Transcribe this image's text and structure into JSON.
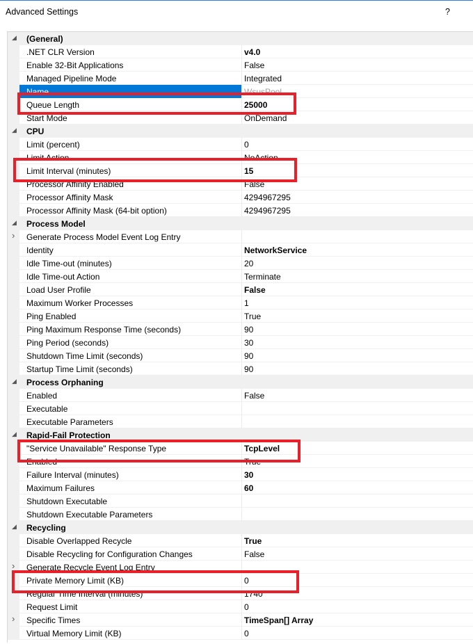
{
  "window": {
    "title": "Advanced Settings",
    "help": "?"
  },
  "groups": [
    {
      "category": "(General)",
      "rows": [
        {
          "name": ".NET CLR Version",
          "value": "v4.0",
          "bold": true
        },
        {
          "name": "Enable 32-Bit Applications",
          "value": "False"
        },
        {
          "name": "Managed Pipeline Mode",
          "value": "Integrated"
        },
        {
          "name": "Name",
          "value": "WsusPool",
          "selected": true
        },
        {
          "name": "Queue Length",
          "value": "25000",
          "bold": true
        },
        {
          "name": "Start Mode",
          "value": "OnDemand"
        }
      ]
    },
    {
      "category": "CPU",
      "rows": [
        {
          "name": "Limit (percent)",
          "value": "0"
        },
        {
          "name": "Limit Action",
          "value": "NoAction"
        },
        {
          "name": "Limit Interval (minutes)",
          "value": "15",
          "bold": true
        },
        {
          "name": "Processor Affinity Enabled",
          "value": "False"
        },
        {
          "name": "Processor Affinity Mask",
          "value": "4294967295"
        },
        {
          "name": "Processor Affinity Mask (64-bit option)",
          "value": "4294967295"
        }
      ]
    },
    {
      "category": "Process Model",
      "rows": [
        {
          "name": "Generate Process Model Event Log Entry",
          "value": "",
          "expandable": true
        },
        {
          "name": "Identity",
          "value": "NetworkService",
          "bold": true
        },
        {
          "name": "Idle Time-out (minutes)",
          "value": "20"
        },
        {
          "name": "Idle Time-out Action",
          "value": "Terminate"
        },
        {
          "name": "Load User Profile",
          "value": "False",
          "bold": true
        },
        {
          "name": "Maximum Worker Processes",
          "value": "1"
        },
        {
          "name": "Ping Enabled",
          "value": "True"
        },
        {
          "name": "Ping Maximum Response Time (seconds)",
          "value": "90"
        },
        {
          "name": "Ping Period (seconds)",
          "value": "30"
        },
        {
          "name": "Shutdown Time Limit (seconds)",
          "value": "90"
        },
        {
          "name": "Startup Time Limit (seconds)",
          "value": "90"
        }
      ]
    },
    {
      "category": "Process Orphaning",
      "rows": [
        {
          "name": "Enabled",
          "value": "False"
        },
        {
          "name": "Executable",
          "value": ""
        },
        {
          "name": "Executable Parameters",
          "value": ""
        }
      ]
    },
    {
      "category": "Rapid-Fail Protection",
      "rows": [
        {
          "name": "\"Service Unavailable\" Response Type",
          "value": "TcpLevel",
          "bold": true
        },
        {
          "name": "Enabled",
          "value": "True"
        },
        {
          "name": "Failure Interval (minutes)",
          "value": "30",
          "bold": true
        },
        {
          "name": "Maximum Failures",
          "value": "60",
          "bold": true
        },
        {
          "name": "Shutdown Executable",
          "value": ""
        },
        {
          "name": "Shutdown Executable Parameters",
          "value": ""
        }
      ]
    },
    {
      "category": "Recycling",
      "rows": [
        {
          "name": "Disable Overlapped Recycle",
          "value": "True",
          "bold": true
        },
        {
          "name": "Disable Recycling for Configuration Changes",
          "value": "False"
        },
        {
          "name": "Generate Recycle Event Log Entry",
          "value": "",
          "expandable": true
        },
        {
          "name": "Private Memory Limit (KB)",
          "value": "0"
        },
        {
          "name": "Regular Time Interval (minutes)",
          "value": "1740"
        },
        {
          "name": "Request Limit",
          "value": "0"
        },
        {
          "name": "Specific Times",
          "value": "TimeSpan[] Array",
          "bold": true,
          "expandable": true
        },
        {
          "name": "Virtual Memory Limit (KB)",
          "value": "0"
        }
      ]
    }
  ],
  "colors": {
    "highlight": "#e8202a",
    "selection": "#0078d7"
  }
}
